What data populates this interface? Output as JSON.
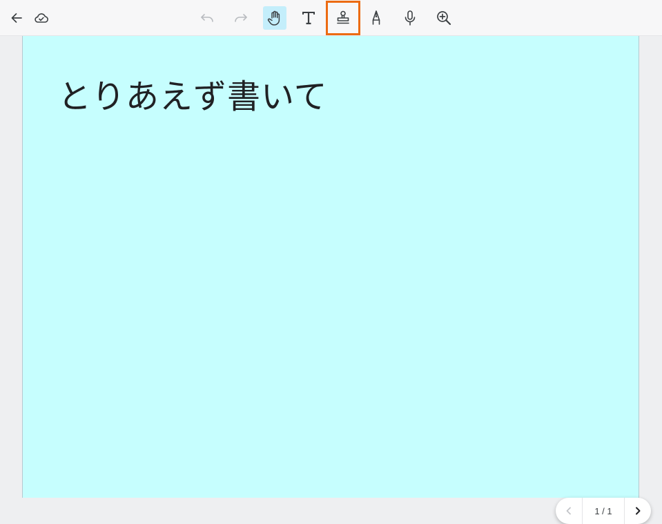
{
  "toolbar": {
    "left_icons": [
      "back-arrow-icon",
      "cloud-sync-icon"
    ],
    "tools": [
      {
        "name": "undo",
        "icon": "undo-icon",
        "state": "disabled"
      },
      {
        "name": "redo",
        "icon": "redo-icon",
        "state": "disabled"
      },
      {
        "name": "hand",
        "icon": "hand-icon",
        "state": "active"
      },
      {
        "name": "text",
        "icon": "text-T-icon",
        "state": "normal"
      },
      {
        "name": "stamp",
        "icon": "stamp-icon",
        "state": "highlighted"
      },
      {
        "name": "pen",
        "icon": "pen-nib-icon",
        "state": "normal"
      },
      {
        "name": "voice",
        "icon": "microphone-icon",
        "state": "normal"
      },
      {
        "name": "zoom",
        "icon": "zoom-in-icon",
        "state": "normal"
      }
    ],
    "colors": {
      "active_bg": "#c4eefb",
      "highlight_border": "#ec6b12",
      "disabled_icon": "#b9bcc0"
    }
  },
  "canvas": {
    "text": "とりあえず書いて",
    "background": "#c6fefe"
  },
  "pager": {
    "label": "1 / 1",
    "prev_state": "disabled",
    "next_state": "enabled"
  }
}
